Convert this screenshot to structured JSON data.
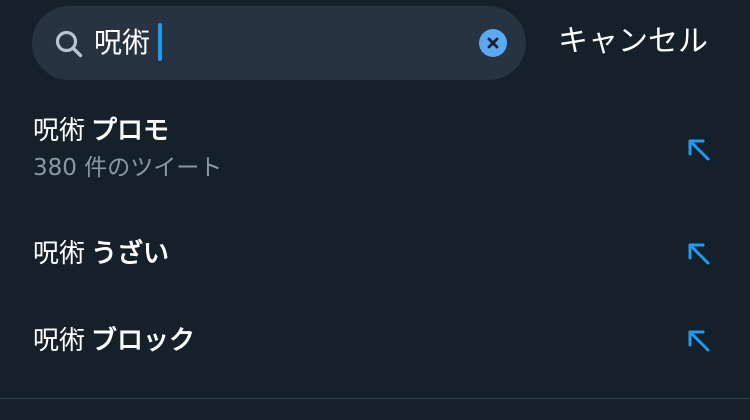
{
  "search": {
    "query": "呪術",
    "cancel_label": "キャンセル"
  },
  "suggestions": [
    {
      "prefix": "呪術",
      "suffix": "プロモ",
      "sub": "380 件のツイート"
    },
    {
      "prefix": "呪術",
      "suffix": "うざい"
    },
    {
      "prefix": "呪術",
      "suffix": "ブロック"
    }
  ],
  "icons": {
    "search": "search-icon",
    "clear": "close-circle-icon",
    "fill_query": "arrow-up-left-icon"
  },
  "colors": {
    "background": "#15202b",
    "search_bar": "#273340",
    "accent": "#1d9bf0",
    "secondary_text": "#8899a6"
  }
}
